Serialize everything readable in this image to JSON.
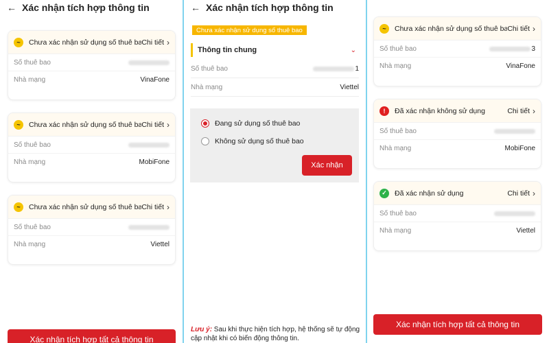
{
  "app": {
    "title": "Xác nhận tích hợp thông tin",
    "back_glyph": "←"
  },
  "labels": {
    "subscriber": "Số thuê bao",
    "carrier": "Nhà mạng",
    "detail": "Chi tiết",
    "chevron": "›",
    "confirm_all": "Xác nhận tích hợp tất cả thông tin"
  },
  "status_text": {
    "pending": "Chưa xác nhận sử dụng số thuê bao",
    "not_in_use": "Đã xác nhận không sử dụng",
    "in_use": "Đã xác nhận sử dụng"
  },
  "status_icons": {
    "pending": "~",
    "not_in_use": "!",
    "in_use": "✓"
  },
  "panel1": {
    "cards": [
      {
        "status": "Chưa xác nhận sử dụng số thuê bao",
        "icon": "pending-icon",
        "subscriber_suffix": "",
        "carrier": "VinaFone"
      },
      {
        "status": "Chưa xác nhận sử dụng số thuê bao",
        "icon": "pending-icon",
        "subscriber_suffix": "",
        "carrier": "MobiFone"
      },
      {
        "status": "Chưa xác nhận sử dụng số thuê bao",
        "icon": "pending-icon",
        "subscriber_suffix": "",
        "carrier": "Viettel"
      }
    ]
  },
  "panel2": {
    "tag": "Chưa xác nhận sử dụng số thuê bao",
    "section_title": "Thông tin chung",
    "section_chevron": "⌄",
    "subscriber_suffix": "1",
    "carrier": "Viettel",
    "options": [
      {
        "label": "Đang sử dụng số thuê bao",
        "selected": true
      },
      {
        "label": "Không sử dụng số thuê bao",
        "selected": false
      }
    ],
    "confirm_button": "Xác nhận",
    "note_label": "Lưu ý:",
    "note_text": " Sau khi thực hiện tích hợp, hệ thống sẽ tự động cập nhật khi có biến động thông tin."
  },
  "panel3": {
    "cards": [
      {
        "status": "Chưa xác nhận sử dụng số thuê bao",
        "icon": "pending-icon",
        "subscriber_suffix": "3",
        "carrier": "VinaFone"
      },
      {
        "status": "Đã xác nhận không sử dụng",
        "icon": "warning-icon",
        "subscriber_suffix": "",
        "carrier": "MobiFone"
      },
      {
        "status": "Đã xác nhận sử dụng",
        "icon": "check-icon",
        "subscriber_suffix": "",
        "carrier": "Viettel"
      }
    ]
  },
  "colors": {
    "accent_red": "#d82128",
    "pending_yellow": "#f5c400",
    "success_green": "#2eb24a",
    "divider_blue": "#7fd3ee"
  }
}
